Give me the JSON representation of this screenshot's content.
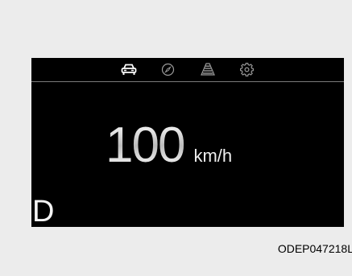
{
  "cluster": {
    "icons": [
      "car-icon",
      "compass-icon",
      "lane-icon",
      "settings-icon"
    ],
    "speed": "100",
    "unit": "km/h",
    "gear": "D"
  },
  "figure_code": "ODEP047218L",
  "colors": {
    "background": "#ececec",
    "display": "#000000",
    "active_icon": "#ffffff",
    "inactive_icon": "#9a9a9a",
    "divider": "#7c7c7c"
  }
}
